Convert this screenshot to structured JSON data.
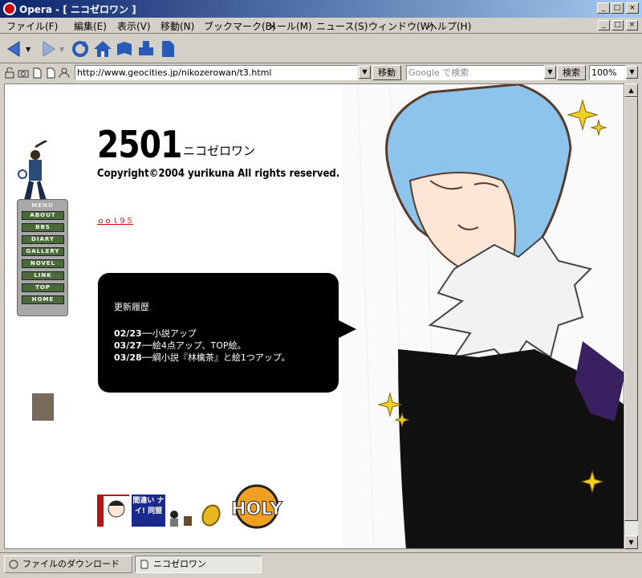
{
  "window": {
    "title": "Opera - [ ニコゼロワン ]",
    "minimize_glyph": "_",
    "maximize_glyph": "□",
    "close_glyph": "×"
  },
  "menubar": {
    "items": [
      "ファイル(F)",
      "編集(E)",
      "表示(V)",
      "移動(N)",
      "ブックマーク(B)",
      "メール(M)",
      "ニュース(S)",
      "ウィンドウ(W)",
      "ヘルプ(H)"
    ]
  },
  "toolbar": {
    "icons": [
      "back-icon",
      "forward-icon",
      "reload-icon",
      "home-icon",
      "bookmarks-icon",
      "print-icon",
      "document-icon"
    ]
  },
  "addressbar": {
    "url": "http://www.geocities.jp/nikozerowan/t3.html",
    "go_label": "移動",
    "search_placeholder": "Google で検索",
    "search_label": "検索",
    "zoom": "100%"
  },
  "page": {
    "title_num": "2501",
    "title_name": "ニコゼロワン",
    "copyright": "Copyright©2004 yurikuna All rights reserved.",
    "counter": "ｏｏｌ９５",
    "menu_header": "MENU",
    "nav": [
      "ABOUT",
      "BBS",
      "DIARY",
      "GALLERY",
      "NOVEL",
      "LINK",
      "TOP",
      "HOME"
    ],
    "history_title": "更新履歴",
    "history": [
      {
        "date": "02/23",
        "text": "──小説アップ"
      },
      {
        "date": "03/27",
        "text": "──絵4点アップ、TOP絵。"
      },
      {
        "date": "03/28",
        "text": "──綱小説『林檎茶』と絵1つアップ。"
      }
    ],
    "banner_text": "間違い ナイ! 同盟",
    "banner_logo": "LOVE HOLY"
  },
  "statusbar": {
    "download_tab": "ファイルのダウンロード",
    "page_tab": "ニコゼロワン"
  },
  "colors": {
    "titlebar_start": "#0a246a",
    "titlebar_end": "#a6caf0",
    "nav_button": "#4a6a3a",
    "bubble": "#000000"
  }
}
